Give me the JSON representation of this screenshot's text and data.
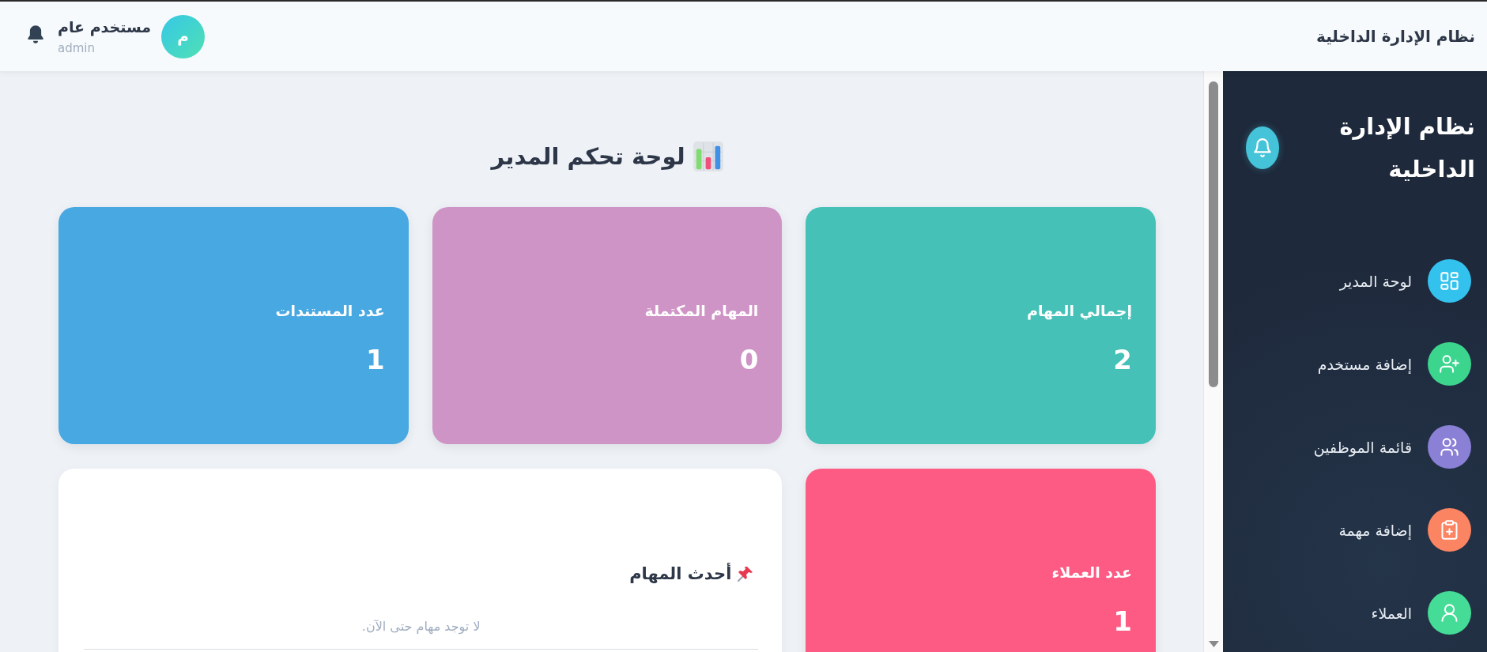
{
  "topbar": {
    "title": "نظام الإدارة الداخلية",
    "user": {
      "name": "مستخدم عام",
      "role": "admin",
      "avatar_letter": "م"
    }
  },
  "sidebar": {
    "title": "نظام الإدارة الداخلية",
    "items": [
      {
        "label": "لوحة المدير",
        "color": "#33c2ee"
      },
      {
        "label": "إضافة مستخدم",
        "color": "#3cd58e"
      },
      {
        "label": "قائمة الموظفين",
        "color": "#8a80d6"
      },
      {
        "label": "إضافة مهمة",
        "color": "#fb8462"
      },
      {
        "label": "العملاء",
        "color": "#44dc96"
      }
    ]
  },
  "main": {
    "heading": "لوحة تحكم المدير",
    "stats": [
      {
        "label": "إجمالي المهام",
        "value": "2",
        "color": "#45c1b8"
      },
      {
        "label": "المهام المكتملة",
        "value": "0",
        "color": "#cf94c6"
      },
      {
        "label": "عدد المستندات",
        "value": "1",
        "color": "#48a8e1"
      },
      {
        "label": "عدد العملاء",
        "value": "1",
        "color": "#fd5b84"
      }
    ],
    "recent_tasks": {
      "title": "أحدث المهام",
      "empty_message": "لا توجد مهام حتى الآن."
    }
  }
}
